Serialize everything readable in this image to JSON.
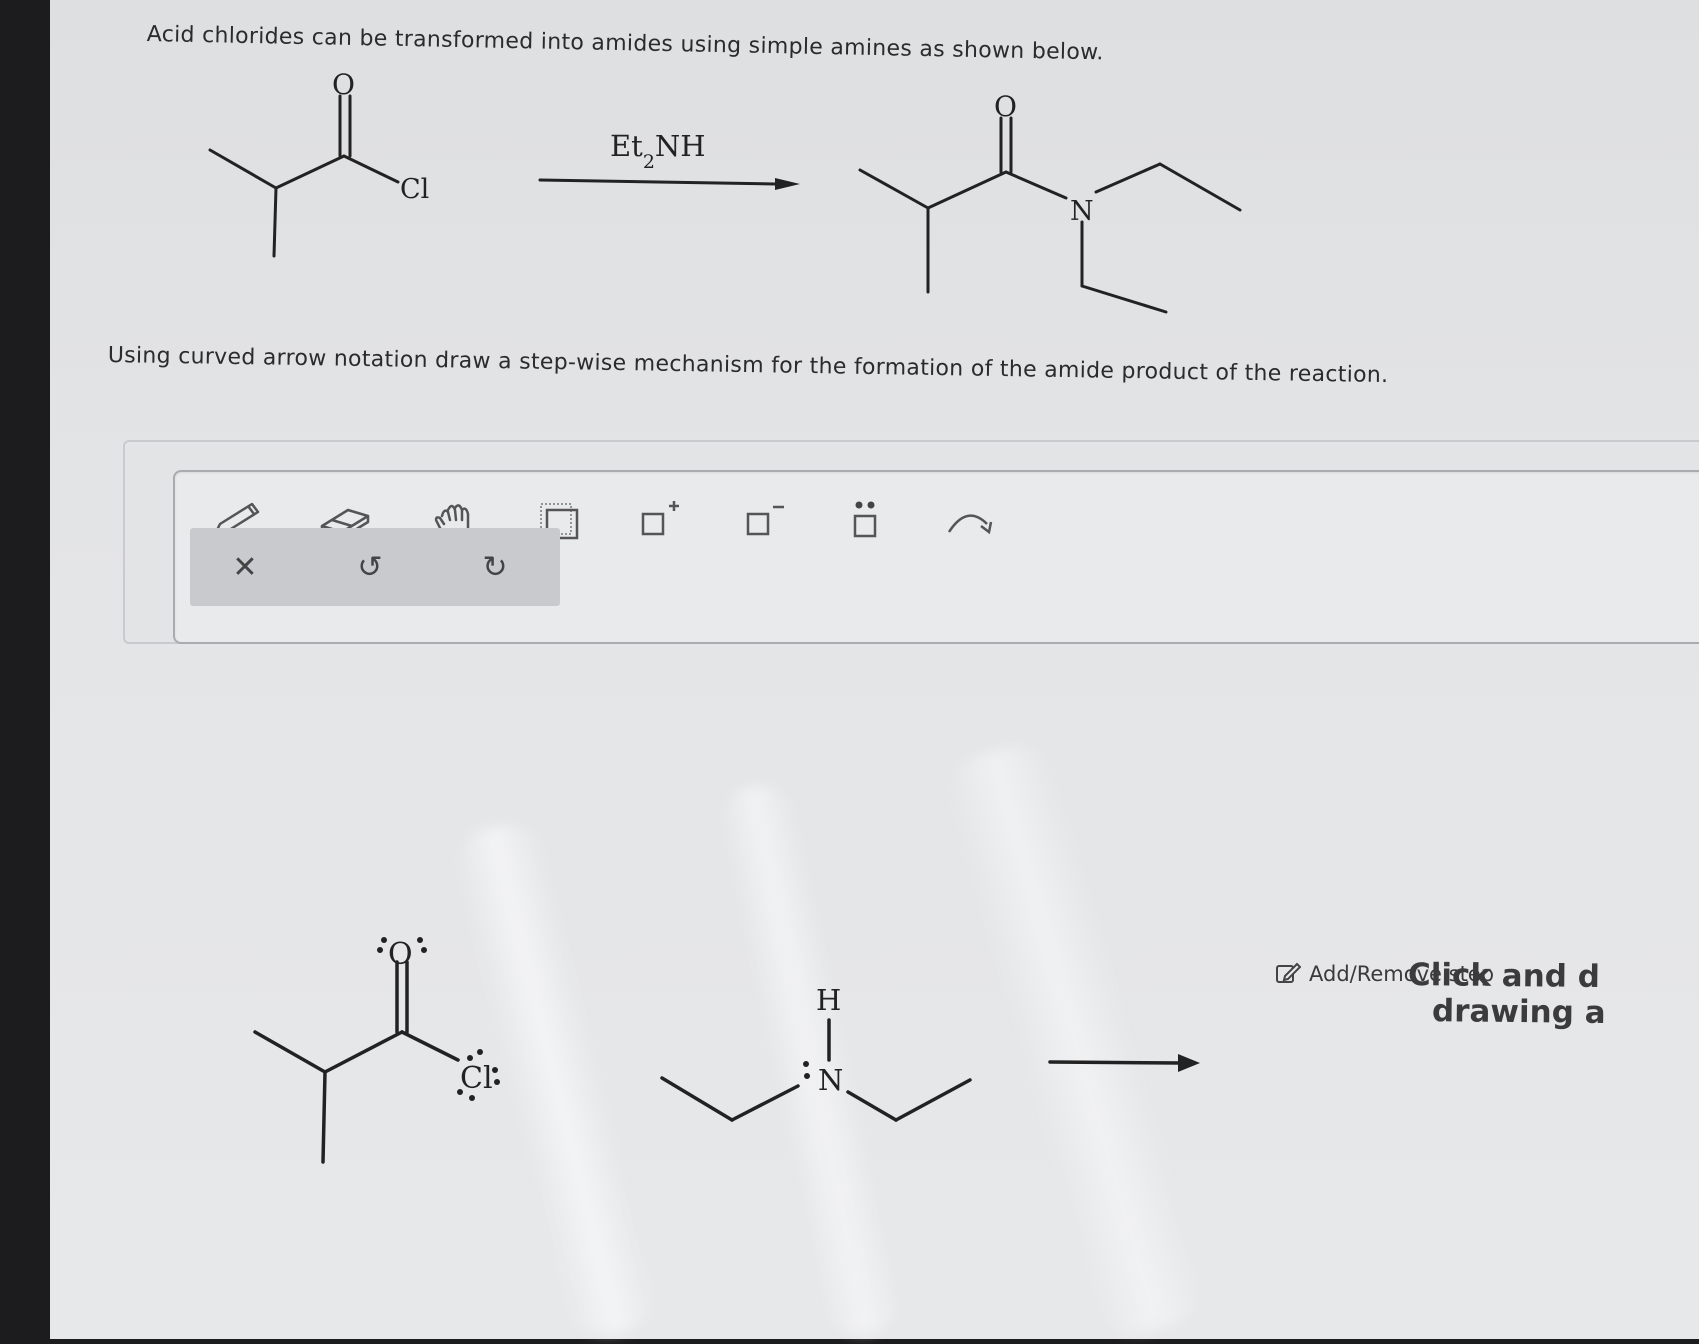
{
  "question": {
    "intro": "Acid chlorides can be transformed into amides using simple amines as shown below.",
    "instruction": "Using curved arrow notation draw a step-wise mechanism for the formation of the amide product of the reaction."
  },
  "reaction": {
    "reactant": {
      "oxygen": "O",
      "chlorine": "Cl"
    },
    "reagent_main": "Et",
    "reagent_sub": "2",
    "reagent_tail": "NH",
    "product": {
      "oxygen": "O",
      "nitrogen": "N"
    }
  },
  "toolbar": {
    "tools": [
      {
        "name": "pencil-tool",
        "icon": "pencil-icon"
      },
      {
        "name": "eraser-tool",
        "icon": "eraser-icon"
      },
      {
        "name": "hand-tool",
        "icon": "hand-icon"
      },
      {
        "name": "select-tool",
        "icon": "selection-box-icon"
      },
      {
        "name": "positive-charge-tool",
        "icon": "plus-charge-icon"
      },
      {
        "name": "negative-charge-tool",
        "icon": "minus-charge-icon"
      },
      {
        "name": "lone-pair-tool",
        "icon": "lone-pair-icon"
      },
      {
        "name": "curved-arrow-tool",
        "icon": "curved-arrow-icon"
      }
    ],
    "add_remove_label": "Add/Remove step",
    "sub_actions": [
      {
        "name": "clear",
        "glyph": "✕"
      },
      {
        "name": "undo",
        "glyph": "↺"
      },
      {
        "name": "redo",
        "glyph": "↻"
      }
    ]
  },
  "canvas": {
    "acyl_oxygen": "O",
    "acyl_chlorine": "Cl",
    "amine_h": "H",
    "amine_n": "N",
    "cta_line1": "Click and d",
    "cta_line2": "drawing a"
  }
}
